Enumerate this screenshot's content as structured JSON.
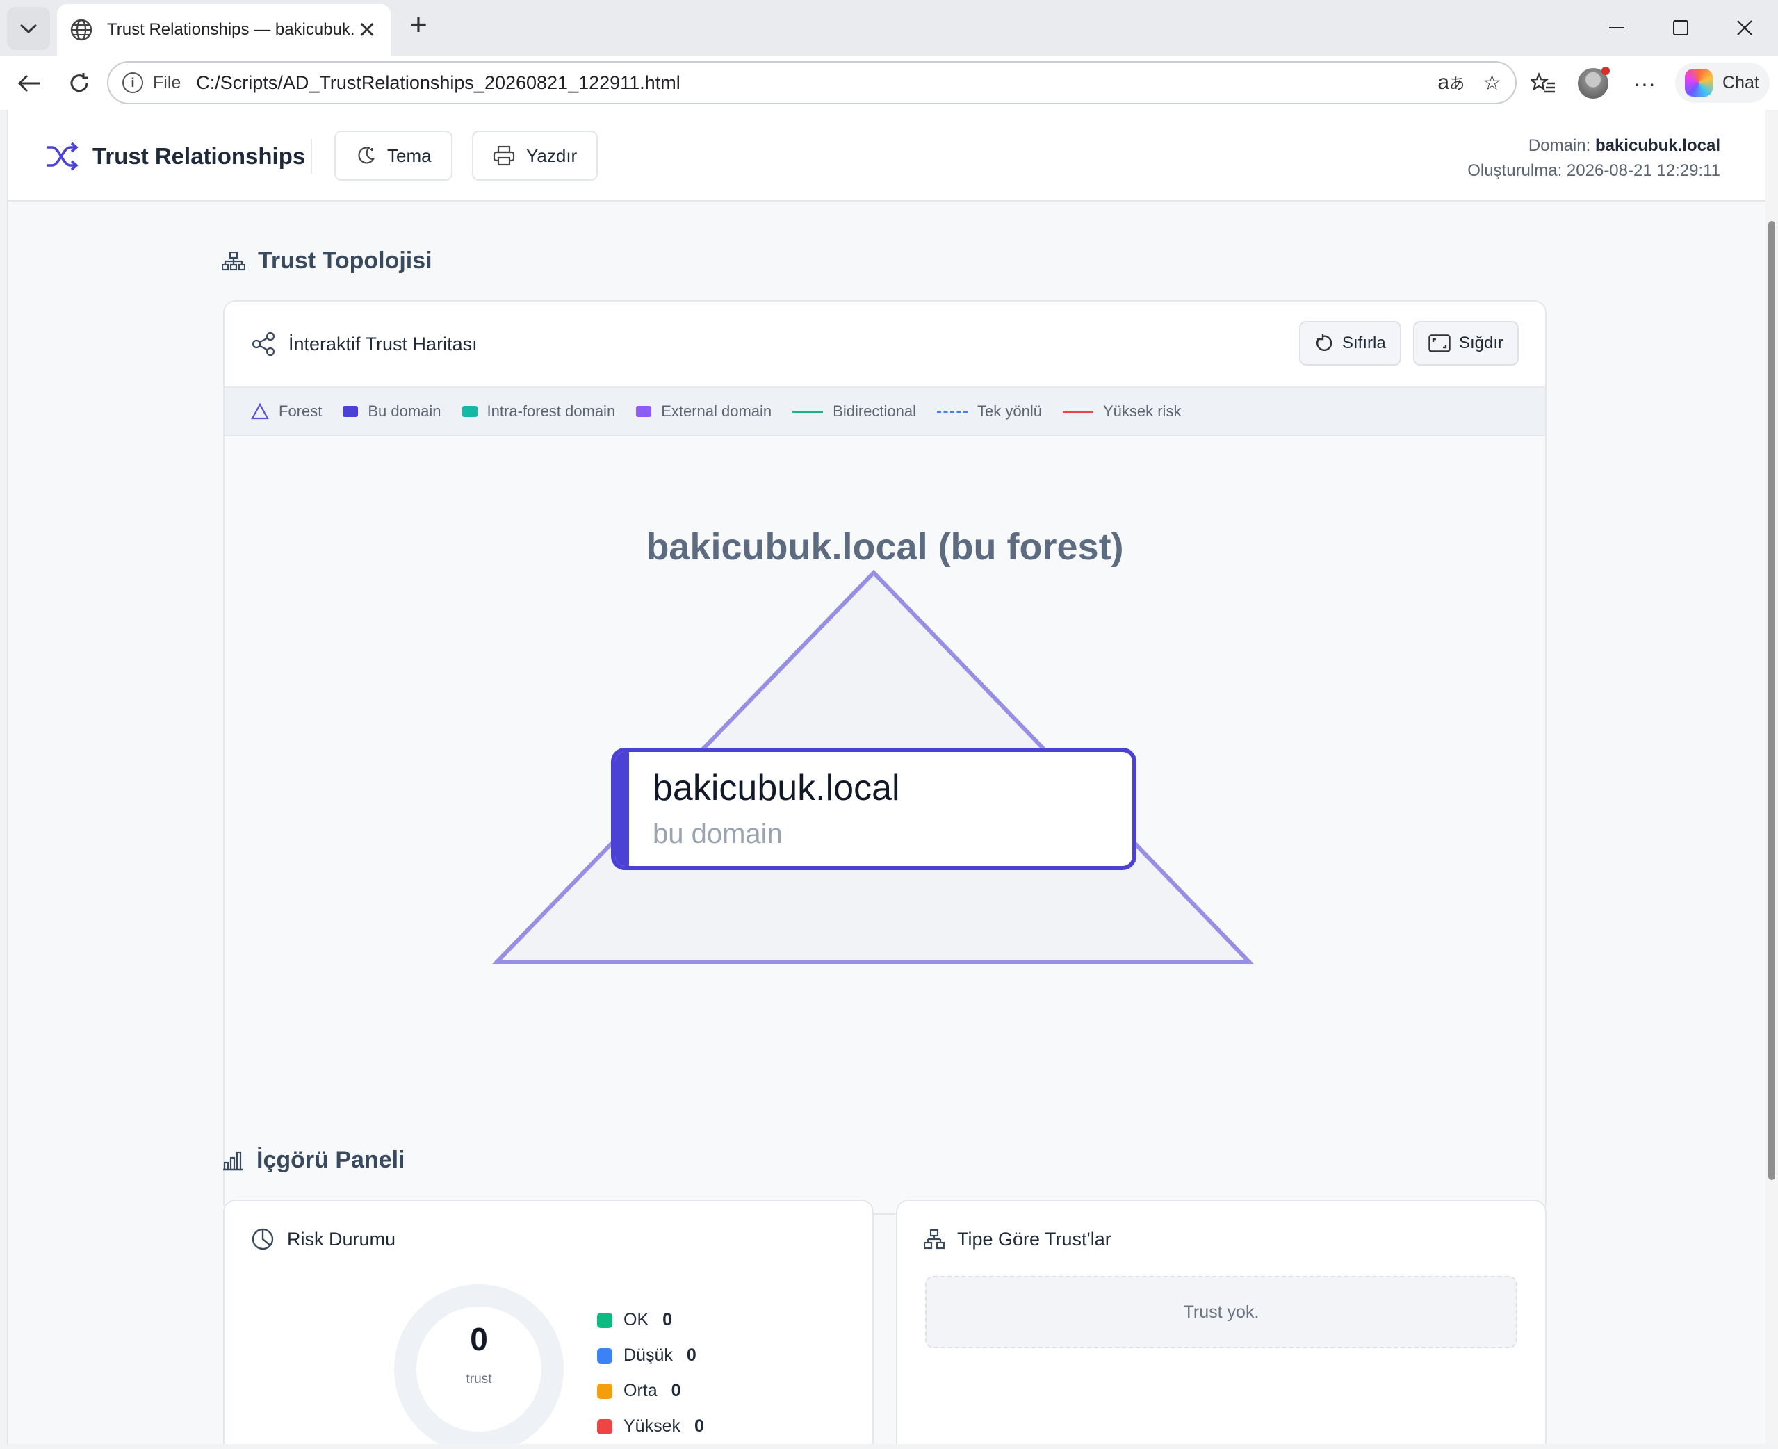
{
  "browser": {
    "tab_title": "Trust Relationships — bakicubuk.local",
    "address_scheme": "File",
    "url": "C:/Scripts/AD_TrustRelationships_20260821_122911.html",
    "chat_label": "Chat"
  },
  "header": {
    "title": "Trust Relationships",
    "theme_button": "Tema",
    "print_button": "Yazdır",
    "domain_label": "Domain:",
    "domain_value": "bakicubuk.local",
    "created_label": "Oluşturulma:",
    "created_value": "2026-08-21 12:29:11"
  },
  "topology": {
    "section_title": "Trust Topolojisi",
    "card_title": "İnteraktif Trust Haritası",
    "reset_button": "Sıfırla",
    "fit_button": "Sığdır",
    "legend": {
      "forest": "Forest",
      "this_domain": "Bu domain",
      "intra_forest": "Intra-forest domain",
      "external": "External domain",
      "bidirectional": "Bidirectional",
      "one_way": "Tek yönlü",
      "high_risk": "Yüksek risk"
    },
    "forest_label": "bakicubuk.local (bu forest)",
    "node_name": "bakicubuk.local",
    "node_subtitle": "bu domain"
  },
  "insights": {
    "section_title": "İçgörü Paneli",
    "risk": {
      "title": "Risk Durumu",
      "total": "0",
      "caption": "trust",
      "levels": [
        {
          "label": "OK",
          "value": "0",
          "color": "#10b981"
        },
        {
          "label": "Düşük",
          "value": "0",
          "color": "#3b82f6"
        },
        {
          "label": "Orta",
          "value": "0",
          "color": "#f59e0b"
        },
        {
          "label": "Yüksek",
          "value": "0",
          "color": "#ef4444"
        }
      ]
    },
    "types": {
      "title": "Tipe Göre Trust'lar",
      "empty": "Trust yok."
    }
  },
  "colors": {
    "accent": "#4b41d4",
    "intra_forest": "#14b8a6",
    "external": "#8b5cf6",
    "bidirectional": "#10b981",
    "one_way": "#3b82f6",
    "high_risk": "#ef4444"
  }
}
